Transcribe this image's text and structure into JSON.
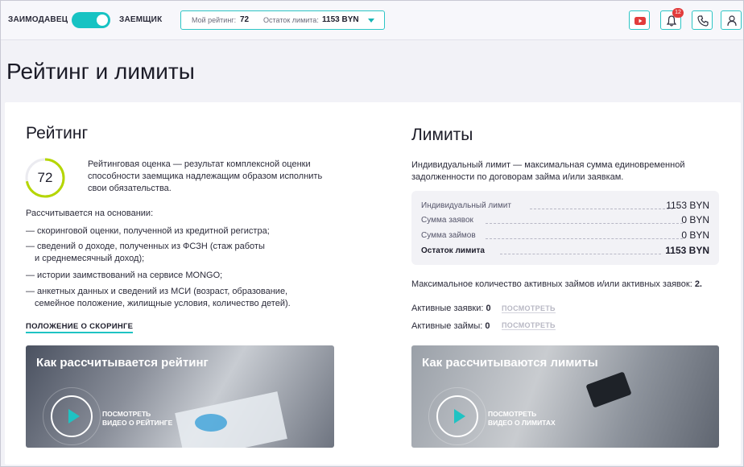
{
  "header": {
    "role_left": "ЗАИМОДАВЕЦ",
    "role_right": "ЗАЕМЩИК",
    "rating_label": "Мой рейтинг:",
    "rating_value": "72",
    "limit_label": "Остаток лимита:",
    "limit_value": "1153 BYN",
    "notifications_count": "12",
    "icons": [
      "youtube-icon",
      "bell-icon",
      "phone-icon",
      "user-icon"
    ]
  },
  "page": {
    "title": "Рейтинг и лимиты"
  },
  "rating": {
    "heading": "Рейтинг",
    "score": "72",
    "description_lines": [
      "Рейтинговая оценка — результат комплексной оценки",
      "способности заемщика надлежащим образом исполнить",
      "свои обязательства."
    ],
    "basis_intro": "Рассчитывается на основании:",
    "basis_items": [
      [
        "— скоринговой оценки, полученной из кредитной регистра;"
      ],
      [
        "— сведений о доходе, полученных из ФСЗН (стаж работы",
        "и среднемесячный доход);"
      ],
      [
        "— истории заимствований на сервисе MONGO;"
      ],
      [
        "— анкетных данных и сведений из МСИ (возраст, образование,",
        "семейное положение, жилищные условия, количество детей)."
      ]
    ],
    "scoring_link": "ПОЛОЖЕНИЕ О СКОРИНГЕ",
    "video_title": "Как рассчитывается рейтинг",
    "video_label_1": "ПОСМОТРЕТЬ",
    "video_label_2": "ВИДЕО О РЕЙТИНГЕ"
  },
  "limits": {
    "heading": "Лимиты",
    "description_lines": [
      "Индивидуальный лимит — максимальная сумма единовременной",
      "задолженности по договорам займа и/или заявкам."
    ],
    "rows": [
      {
        "label": "Индивидуальный лимит",
        "value": "1153 BYN"
      },
      {
        "label": "Сумма заявок",
        "value": "0 BYN"
      },
      {
        "label": "Сумма займов",
        "value": "0 BYN"
      },
      {
        "label": "Остаток лимита",
        "value": "1153 BYN"
      }
    ],
    "max_active_text": "Максимальное количество активных займов и/или активных заявок:",
    "max_active_value": "2.",
    "active_requests_label": "Активные заявки:",
    "active_requests_value": "0",
    "active_loans_label": "Активные займы:",
    "active_loans_value": "0",
    "view_label": "ПОСМОТРЕТЬ",
    "video_title": "Как рассчитываются лимиты",
    "video_label_1": "ПОСМОТРЕТЬ",
    "video_label_2": "ВИДЕО О ЛИМИТАХ"
  },
  "colors": {
    "accent": "#1fc3c3",
    "badge": "#e23b3b",
    "ring": "#b5d600"
  }
}
